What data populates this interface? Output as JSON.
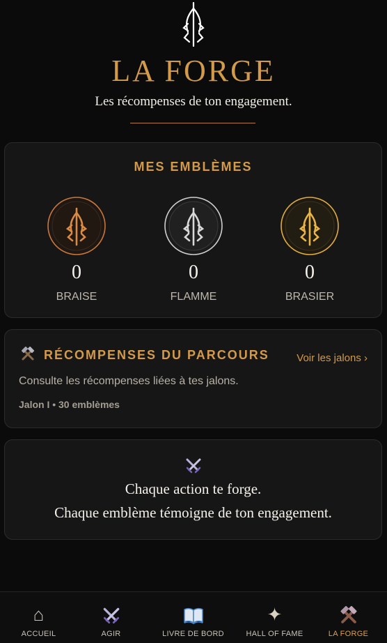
{
  "header": {
    "title": "LA FORGE",
    "subtitle": "Les récompenses de ton engagement.",
    "logo_icon": "trident-flame-icon"
  },
  "emblems": {
    "title": "MES EMBLÈMES",
    "items": [
      {
        "label": "BRAISE",
        "count": "0",
        "color": "#c9773a",
        "icon": "braise-emblem-icon"
      },
      {
        "label": "FLAMME",
        "count": "0",
        "color": "#cfcfcf",
        "icon": "flamme-emblem-icon"
      },
      {
        "label": "BRASIER",
        "count": "0",
        "color": "#e0ac3e",
        "icon": "brasier-emblem-icon"
      }
    ]
  },
  "parcours": {
    "icon": "hammer-pick-icon",
    "title": "RÉCOMPENSES DU PARCOURS",
    "link": "Voir les jalons ›",
    "description": "Consulte les récompenses liées à tes jalons.",
    "meta": "Jalon I • 30 emblèmes"
  },
  "quote": {
    "icon": "crossed-swords-icon",
    "line1": "Chaque action te forge.",
    "line2": "Chaque emblème témoigne de ton engagement."
  },
  "nav": {
    "items": [
      {
        "label": "ACCUEIL",
        "icon": "home-icon",
        "glyph": "⌂"
      },
      {
        "label": "AGIR",
        "icon": "crossed-swords-icon",
        "glyph": ""
      },
      {
        "label": "LIVRE DE BORD",
        "icon": "book-icon",
        "glyph": ""
      },
      {
        "label": "HALL OF FAME",
        "icon": "sparkle-icon",
        "glyph": "✦"
      },
      {
        "label": "LA FORGE",
        "icon": "hammer-pick-icon",
        "glyph": ""
      }
    ],
    "active": "LA FORGE"
  },
  "colors": {
    "accent": "#d39a4a",
    "background": "#0b0b0b",
    "card": "#161616"
  }
}
